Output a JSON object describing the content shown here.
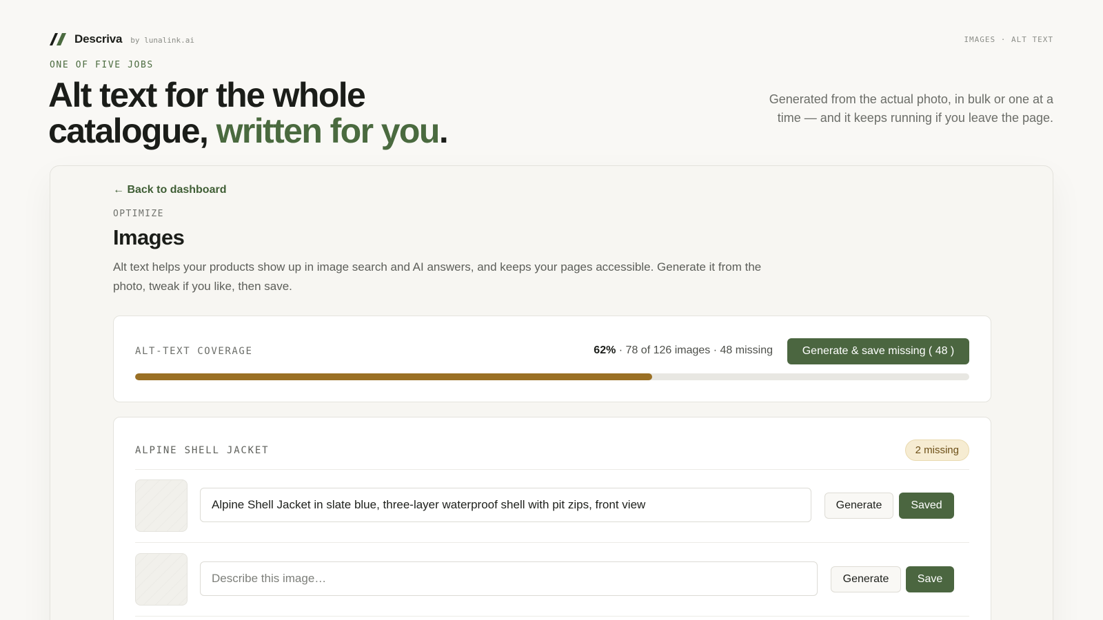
{
  "brand": {
    "name": "Descriva",
    "byline": "by lunalink.ai",
    "breadcrumb": "IMAGES · ALT TEXT",
    "accent_color": "#4b6640"
  },
  "hero": {
    "eyebrow": "ONE OF FIVE JOBS",
    "headline_line1": "Alt text for the whole",
    "headline_line2_prefix": "catalogue, ",
    "headline_accent": "written for you",
    "headline_suffix": ".",
    "lede": "Generated from the actual photo, in bulk or one at a time — and it keeps running if you leave the page."
  },
  "page": {
    "back_link": "← Back to dashboard",
    "section_eyebrow": "OPTIMIZE",
    "title": "Images",
    "description": "Alt text helps your products show up in image search and AI answers, and keeps your pages accessible. Generate it from the photo, tweak if you like, then save."
  },
  "coverage": {
    "label": "ALT-TEXT COVERAGE",
    "percent_text": "62%",
    "stats_text": " · 78 of 126 images · 48 missing",
    "button_label": "Generate & save missing (  48  )",
    "progress": 0.62,
    "progress_color": "#9a7025"
  },
  "product": {
    "title": "ALPINE SHELL JACKET",
    "badge": "2 missing",
    "rows": [
      {
        "value": "Alpine Shell Jacket in slate blue, three-layer waterproof shell with pit zips, front view",
        "placeholder": "Describe this image…",
        "generate_label": "Generate",
        "save_label": "Saved"
      },
      {
        "value": "",
        "placeholder": "Describe this image…",
        "generate_label": "Generate",
        "save_label": "Save"
      }
    ]
  }
}
